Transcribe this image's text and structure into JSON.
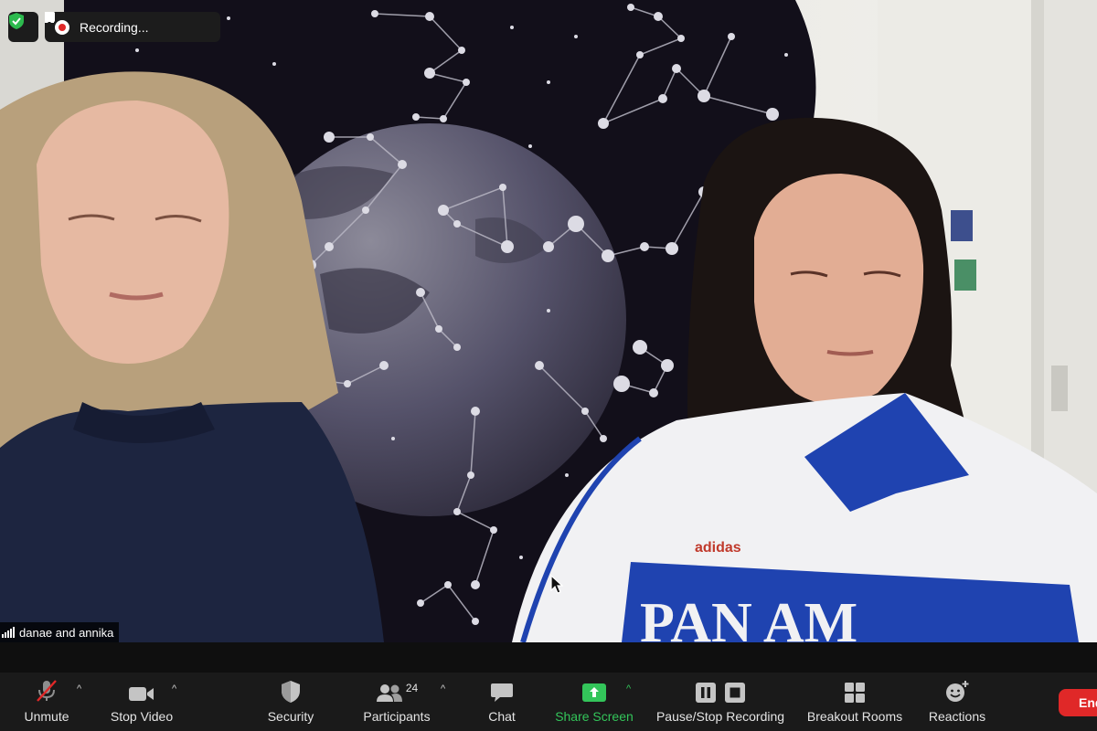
{
  "recording": {
    "status_text": "Recording...",
    "pause_icon": "pause-icon",
    "stop_icon": "stop-icon"
  },
  "security_indicator_icon": "shield-check-icon",
  "participant_label": "danae and annika",
  "toolbar": {
    "unmute_label": "Unmute",
    "stop_video_label": "Stop Video",
    "security_label": "Security",
    "participants_label": "Participants",
    "participants_count": "24",
    "chat_label": "Chat",
    "share_screen_label": "Share Screen",
    "pause_stop_recording_label": "Pause/Stop Recording",
    "breakout_rooms_label": "Breakout Rooms",
    "reactions_label": "Reactions",
    "end_label": "End"
  },
  "colors": {
    "toolbar_bg": "#1a1a1a",
    "share_green": "#33c55a",
    "end_red": "#e02828",
    "recording_red": "#e02828",
    "security_green": "#2dba4e"
  }
}
